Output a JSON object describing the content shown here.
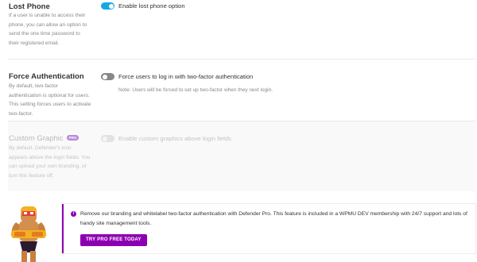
{
  "lost_phone": {
    "title": "Lost Phone",
    "description": "If a user is unable to access their phone, you can allow an option to send the one time password to their registered email.",
    "toggle_label": "Enable lost phone option",
    "toggle_on": true
  },
  "force_auth": {
    "title": "Force Authentication",
    "description": "By default, two-factor authentication is optional for users. This setting forces users to activate two-factor.",
    "toggle_label": "Force users to log in with two-factor authentication",
    "toggle_on": false,
    "note": "Note: Users will be forced to set up two-factor when they next login."
  },
  "custom_graphic": {
    "title": "Custom Graphic",
    "pro_badge": "PRO",
    "description": "By default, Defender's icon appears above the login fields. You can upload your own branding, or turn this feature off.",
    "toggle_label": "Enable custom graphics above login fields",
    "disabled": true
  },
  "upsell": {
    "info_icon": "i",
    "text": "Remove our branding and whitelabel two-factor authentication with Defender Pro. This feature is included in a WPMU DEV membership with 24/7 support and lots of handy site management tools.",
    "button_label": "TRY PRO FREE TODAY",
    "accent_color": "#8d00b1"
  },
  "colors": {
    "toggle_on": "#17a8e3",
    "toggle_off": "#888888"
  }
}
